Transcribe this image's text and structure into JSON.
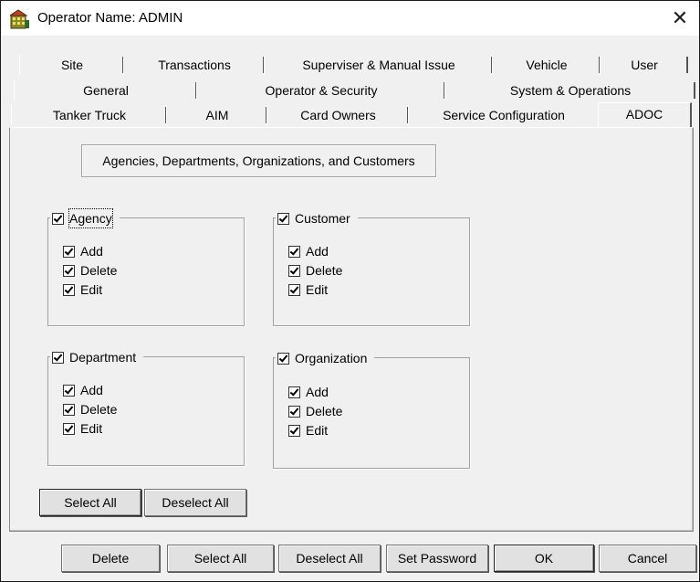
{
  "window": {
    "title": "Operator Name: ADMIN",
    "close_glyph": "✕"
  },
  "tabs": {
    "row1": [
      "Site",
      "Transactions",
      "Superviser & Manual Issue",
      "Vehicle",
      "User"
    ],
    "row2": [
      "General",
      "Operator & Security",
      "System & Operations"
    ],
    "row3": [
      "Tanker Truck",
      "AIM",
      "Card Owners",
      "Service Configuration",
      "ADOC"
    ],
    "active": "ADOC"
  },
  "panel": {
    "heading": "Agencies, Departments, Organizations, and Customers",
    "groups": {
      "agency": {
        "label": "Agency",
        "checked": true,
        "items": [
          "Add",
          "Delete",
          "Edit"
        ]
      },
      "customer": {
        "label": "Customer",
        "checked": true,
        "items": [
          "Add",
          "Delete",
          "Edit"
        ]
      },
      "department": {
        "label": "Department",
        "checked": true,
        "items": [
          "Add",
          "Delete",
          "Edit"
        ]
      },
      "organization": {
        "label": "Organization",
        "checked": true,
        "items": [
          "Add",
          "Delete",
          "Edit"
        ]
      }
    },
    "select_all_label": "Select All",
    "deselect_all_label": "Deselect All"
  },
  "footer": {
    "delete_label": "Delete",
    "select_all_label": "Select All",
    "deselect_all_label": "Deselect All",
    "set_password_label": "Set Password",
    "ok_label": "OK",
    "cancel_label": "Cancel"
  },
  "icons": {
    "app": "building-icon",
    "close": "close-icon",
    "check": "checkmark-icon"
  }
}
